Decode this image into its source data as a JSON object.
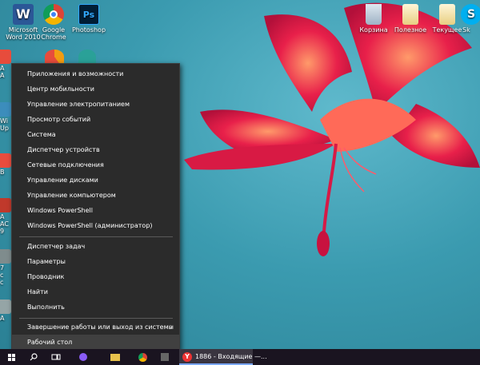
{
  "desktop": {
    "icons": [
      {
        "label": "Microsoft Word 2010",
        "glyph": "W",
        "color": "#2b5797"
      },
      {
        "label": "Google Chrome",
        "glyph": "",
        "color": "#ffffff"
      },
      {
        "label": "Photoshop",
        "glyph": "Ps",
        "color": "#001e36"
      },
      {
        "label": "Корзина",
        "glyph": "",
        "color": "#bcd"
      },
      {
        "label": "Полезное",
        "glyph": "",
        "color": "#f3e3b0"
      },
      {
        "label": "Текущее",
        "glyph": "",
        "color": "#f3e3b0"
      },
      {
        "label": "Sk",
        "glyph": "S",
        "color": "#00aff0"
      }
    ],
    "partial_labels": [
      "A",
      "A",
      "Wi",
      "Up",
      "B",
      "A",
      "AC",
      "9",
      "7",
      "c",
      "с",
      "A"
    ]
  },
  "context_menu": {
    "items": [
      {
        "label": "Приложения и возможности"
      },
      {
        "label": "Центр мобильности"
      },
      {
        "label": "Управление электропитанием"
      },
      {
        "label": "Просмотр событий"
      },
      {
        "label": "Система"
      },
      {
        "label": "Диспетчер устройств"
      },
      {
        "label": "Сетевые подключения"
      },
      {
        "label": "Управление дисками"
      },
      {
        "label": "Управление компьютером"
      },
      {
        "label": "Windows PowerShell"
      },
      {
        "label": "Windows PowerShell (администратор)"
      },
      {
        "label": "Диспетчер задач"
      },
      {
        "label": "Параметры"
      },
      {
        "label": "Проводник"
      },
      {
        "label": "Найти"
      },
      {
        "label": "Выполнить"
      },
      {
        "label": "Завершение работы или выход из системы"
      },
      {
        "label": "Рабочий стол"
      }
    ],
    "submenu_arrow": "›"
  },
  "taskbar": {
    "yandex_button": {
      "label": "1886 - Входящие —...",
      "glyph": "Y"
    },
    "accent": "#7aa7ff"
  }
}
